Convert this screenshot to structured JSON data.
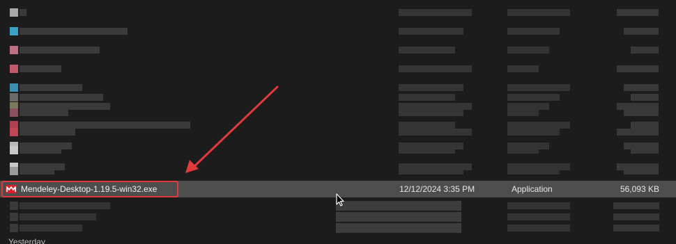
{
  "selected_file": {
    "name": "Mendeley-Desktop-1.19.5-win32.exe",
    "date_modified": "12/12/2024 3:35 PM",
    "type": "Application",
    "size": "56,093 KB",
    "icon": "mendeley-icon"
  },
  "blurred_rows_count": 14,
  "bottom_partial_text": "Yesterday",
  "colors": {
    "background": "#1c1c1c",
    "selected_row": "#4d4d4d",
    "annotation_red": "#e03a3f",
    "mendeley_red": "#d71f29"
  }
}
